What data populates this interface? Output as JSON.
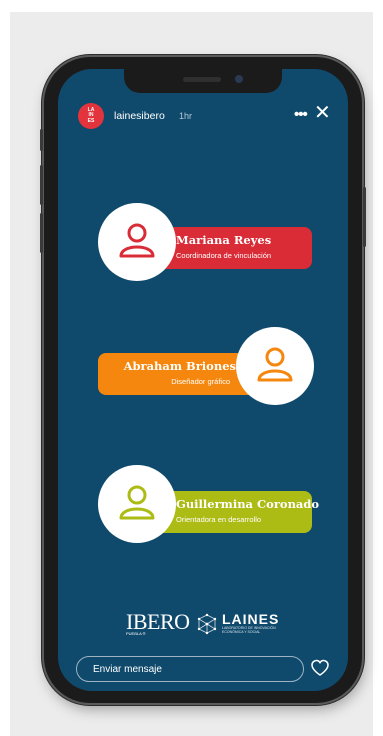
{
  "story": {
    "avatar_text": "LA\nIN\nES",
    "username": "lainesibero",
    "time": "1hr",
    "more": "•••",
    "close": "✕"
  },
  "team": [
    {
      "name": "Mariana Reyes",
      "role": "Coordinadora de vinculación",
      "color": "#d92c36",
      "icon_color": "#d92c36"
    },
    {
      "name": "Abraham Briones",
      "role": "Diseñador gráfico",
      "color": "#f5870f",
      "icon_color": "#f5870f"
    },
    {
      "name": "Guillermina Coronado",
      "role": "Orientadora en desarrollo",
      "color": "#adbb15",
      "icon_color": "#adbb15"
    }
  ],
  "logos": {
    "ibero": "IBERO",
    "ibero_sub": "PUEBLA ®",
    "laines": "LAINES",
    "laines_sub": "LABORATORIO DE INNOVACIÓN ECONÓMICA Y SOCIAL"
  },
  "reply": {
    "placeholder": "Enviar mensaje"
  },
  "icons": [
    "more-icon",
    "close-icon",
    "user-icon",
    "heart-icon",
    "laines-logo-icon"
  ]
}
